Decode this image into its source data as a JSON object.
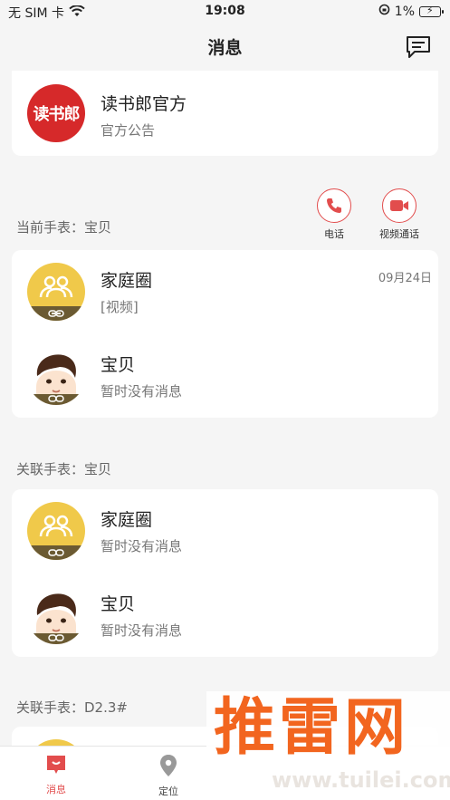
{
  "status_bar": {
    "carrier": "无 SIM 卡",
    "time": "19:08",
    "battery": "1%"
  },
  "nav": {
    "title": "消息"
  },
  "official": {
    "logo_text": "读书郎",
    "title": "读书郎官方",
    "subtitle": "官方公告"
  },
  "current": {
    "label": "当前手表：宝贝",
    "call_label": "电话",
    "video_label": "视频通话",
    "items": [
      {
        "title": "家庭圈",
        "subtitle": "[视频]",
        "date": "09月24日"
      },
      {
        "title": "宝贝",
        "subtitle": "暂时没有消息"
      }
    ]
  },
  "linked1": {
    "label": "关联手表：宝贝",
    "items": [
      {
        "title": "家庭圈",
        "subtitle": "暂时没有消息"
      },
      {
        "title": "宝贝",
        "subtitle": "暂时没有消息"
      }
    ]
  },
  "linked2": {
    "label": "关联手表：D2.3#"
  },
  "tabs": [
    {
      "label": "消息",
      "icon": "message-icon",
      "active": true
    },
    {
      "label": "定位",
      "icon": "location-pin-icon",
      "active": false
    }
  ],
  "watermark": {
    "brand": "推雷网",
    "url": "www.tuilei.com"
  },
  "colors": {
    "accent": "#e24d4d",
    "brand_red": "#d6292a",
    "family_yellow": "#f0c94a",
    "watermark_orange": "#f2651f"
  }
}
